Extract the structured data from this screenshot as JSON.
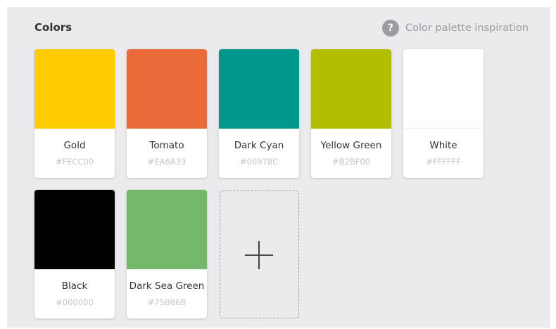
{
  "header": {
    "title": "Colors",
    "inspiration_label": "Color palette inspiration",
    "help_icon_glyph": "?"
  },
  "palette": [
    {
      "name": "Gold",
      "hex": "#FECC00",
      "color": "#FECC00"
    },
    {
      "name": "Tomato",
      "hex": "#EA6A39",
      "color": "#EA6A39"
    },
    {
      "name": "Dark Cyan",
      "hex": "#00978C",
      "color": "#00978C"
    },
    {
      "name": "Yellow Green",
      "hex": "#B2BF00",
      "color": "#B2BF00"
    },
    {
      "name": "White",
      "hex": "#FFFFFF",
      "color": "#FFFFFF"
    },
    {
      "name": "Black",
      "hex": "#000000",
      "color": "#000000"
    },
    {
      "name": "Dark Sea Green",
      "hex": "#75B86B",
      "color": "#75B86B"
    }
  ],
  "add_button": {
    "icon": "plus-icon"
  }
}
